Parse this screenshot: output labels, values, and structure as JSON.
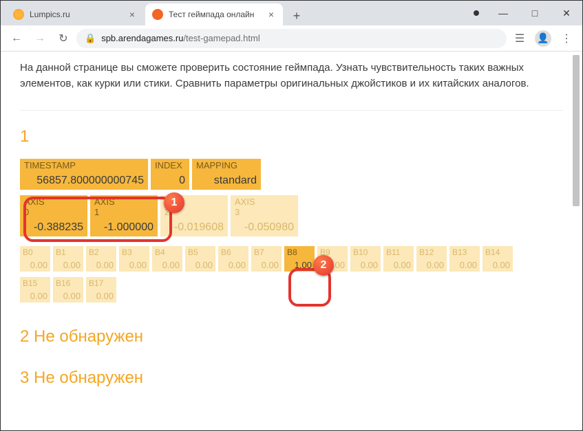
{
  "browser": {
    "tabs": [
      {
        "title": "Lumpics.ru"
      },
      {
        "title": "Тест геймпада онлайн"
      }
    ],
    "url_host": "spb.arendagames.ru",
    "url_path": "/test-gamepad.html"
  },
  "page": {
    "desc": "На данной странице вы сможете проверить состояние геймпада. Узнать чувствительность таких важных элементов, как курки или стики. Сравнить параметры оригинальных джойстиков и их китайских аналогов.",
    "gamepad1": {
      "title": "1",
      "meta": {
        "ts_label": "TIMESTAMP",
        "ts_value": "56857.800000000745",
        "idx_label": "INDEX",
        "idx_value": "0",
        "map_label": "MAPPING",
        "map_value": "standard"
      },
      "axes": [
        {
          "label": "AXIS 0",
          "value": "-0.388235"
        },
        {
          "label": "AXIS 1",
          "value": "-1.000000"
        },
        {
          "label": "AXIS 2",
          "value": "-0.019608"
        },
        {
          "label": "AXIS 3",
          "value": "-0.050980"
        }
      ],
      "buttons_row1": [
        {
          "label": "B0",
          "value": "0.00"
        },
        {
          "label": "B1",
          "value": "0.00"
        },
        {
          "label": "B2",
          "value": "0.00"
        },
        {
          "label": "B3",
          "value": "0.00"
        },
        {
          "label": "B4",
          "value": "0.00"
        },
        {
          "label": "B5",
          "value": "0.00"
        },
        {
          "label": "B6",
          "value": "0.00"
        },
        {
          "label": "B7",
          "value": "0.00"
        },
        {
          "label": "B8",
          "value": "1.00"
        },
        {
          "label": "B9",
          "value": "0.00"
        },
        {
          "label": "B10",
          "value": "0.00"
        },
        {
          "label": "B11",
          "value": "0.00"
        },
        {
          "label": "B12",
          "value": "0.00"
        },
        {
          "label": "B13",
          "value": "0.00"
        },
        {
          "label": "B14",
          "value": "0.00"
        }
      ],
      "buttons_row2": [
        {
          "label": "B15",
          "value": "0.00"
        },
        {
          "label": "B16",
          "value": "0.00"
        },
        {
          "label": "B17",
          "value": "0.00"
        }
      ]
    },
    "gamepad2_title": "2 Не обнаружен",
    "gamepad3_title": "3 Не обнаружен"
  },
  "annotations": {
    "badge1": "1",
    "badge2": "2"
  }
}
